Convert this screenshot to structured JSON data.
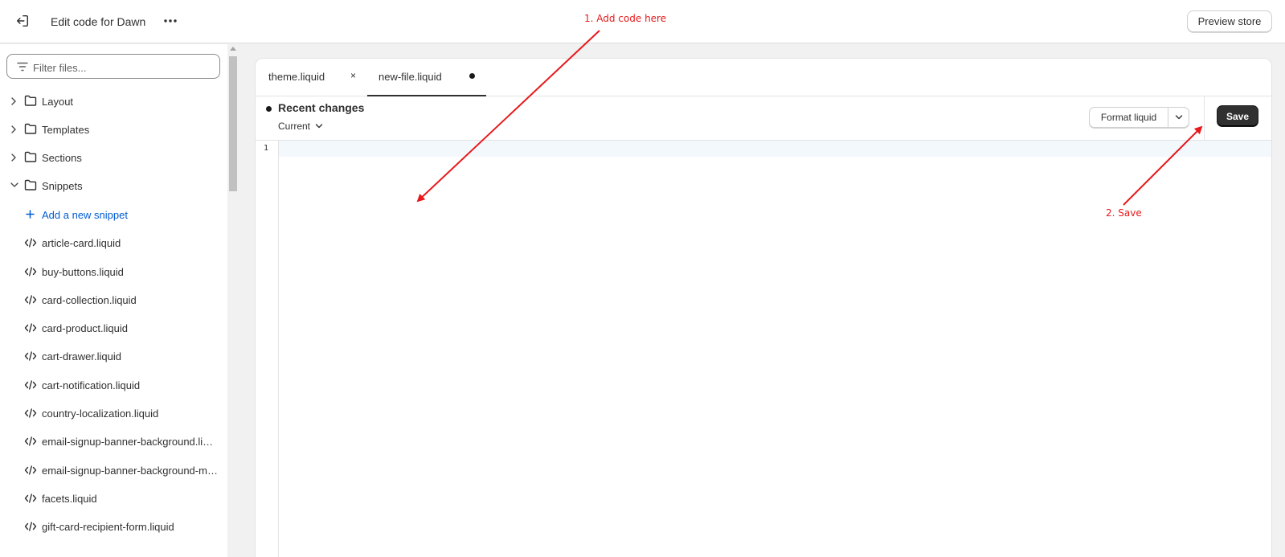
{
  "topbar": {
    "title": "Edit code for Dawn",
    "preview_label": "Preview store"
  },
  "sidebar": {
    "filter_placeholder": "Filter files...",
    "folders": [
      {
        "label": "Layout",
        "expanded": false
      },
      {
        "label": "Templates",
        "expanded": false
      },
      {
        "label": "Sections",
        "expanded": false
      },
      {
        "label": "Snippets",
        "expanded": true
      }
    ],
    "add_snippet_label": "Add a new snippet",
    "files": [
      "article-card.liquid",
      "buy-buttons.liquid",
      "card-collection.liquid",
      "card-product.liquid",
      "cart-drawer.liquid",
      "cart-notification.liquid",
      "country-localization.liquid",
      "email-signup-banner-background.liquid",
      "email-signup-banner-background-mobile.liquid",
      "facets.liquid",
      "gift-card-recipient-form.liquid"
    ]
  },
  "editor": {
    "tabs": [
      {
        "label": "theme.liquid",
        "close": "×",
        "active": false
      },
      {
        "label": "new-file.liquid",
        "unsaved": true,
        "active": true
      }
    ],
    "recent_changes_label": "Recent changes",
    "version_label": "Current",
    "format_label": "Format liquid",
    "save_label": "Save",
    "line_numbers": [
      "1"
    ]
  },
  "annotations": {
    "step1": "1. Add code here",
    "step2": "2. Save",
    "color": "#e8191c"
  },
  "colors": {
    "link": "#005bd3",
    "primary_button": "#303030",
    "active_line": "#f3f8fd"
  }
}
